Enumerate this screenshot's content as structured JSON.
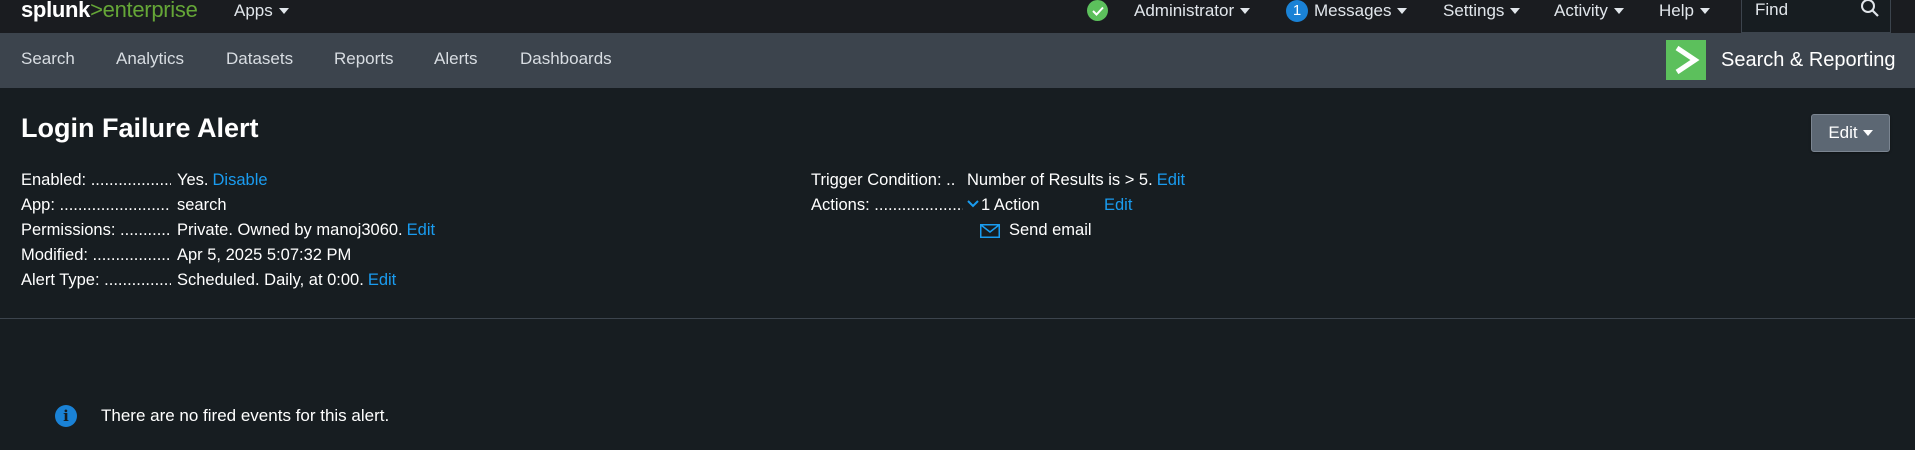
{
  "topbar": {
    "logo_main": "splunk",
    "logo_sep": ">",
    "logo_product": "enterprise",
    "apps_label": "Apps",
    "status_icon": "check-circle-icon",
    "admin_label": "Administrator",
    "messages_count": "1",
    "messages_label": "Messages",
    "settings_label": "Settings",
    "activity_label": "Activity",
    "help_label": "Help",
    "find_placeholder": "Find"
  },
  "appbar": {
    "nav": [
      "Search",
      "Analytics",
      "Datasets",
      "Reports",
      "Alerts",
      "Dashboards"
    ],
    "app_title": "Search & Reporting",
    "app_color": "#5cc05c"
  },
  "alert": {
    "title": "Login Failure Alert",
    "edit_button": "Edit",
    "left": [
      {
        "label": "Enabled: ..................",
        "value": "Yes.",
        "link": "Disable"
      },
      {
        "label": "App: ..........................",
        "value": "search",
        "link": ""
      },
      {
        "label": "Permissions: ...........",
        "value": "Private. Owned by manoj3060.",
        "link": "Edit"
      },
      {
        "label": "Modified: ..................",
        "value": "Apr 5, 2025 5:07:32 PM",
        "link": ""
      },
      {
        "label": "Alert Type: ...............",
        "value": "Scheduled. Daily, at 0:00.",
        "link": "Edit"
      }
    ],
    "trigger_label": "Trigger Condition: ..",
    "trigger_value": "Number of Results is > 5.",
    "trigger_link": "Edit",
    "actions_label": "Actions: ....................",
    "actions_value": "1 Action",
    "actions_link": "Edit",
    "action_item": "Send email"
  },
  "empty_message": "There are no fired events for this alert.",
  "colors": {
    "link": "#1a9cf0",
    "info": "#1a82d6",
    "ok": "#5cc05c"
  }
}
